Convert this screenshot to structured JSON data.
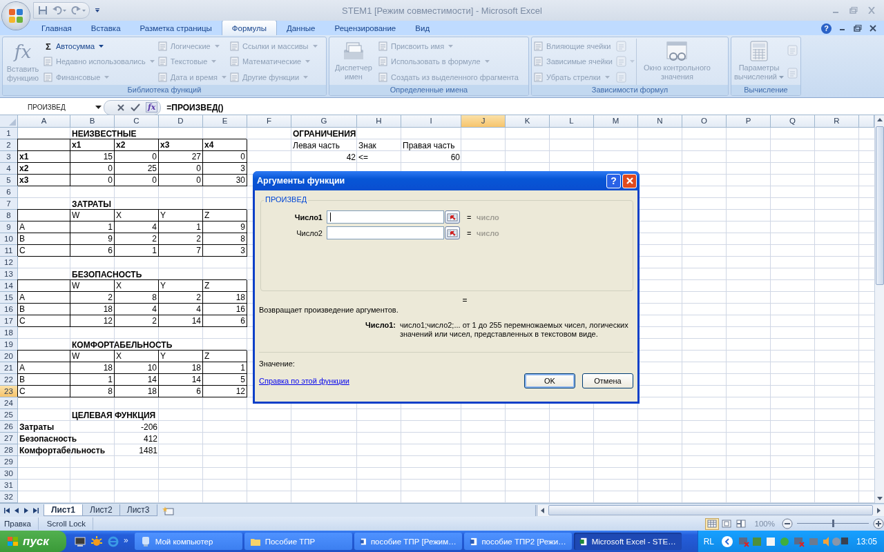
{
  "window": {
    "title": "STEM1  [Режим совместимости] - Microsoft Excel"
  },
  "ribbon": {
    "tabs": [
      {
        "label": "Главная",
        "selected": false
      },
      {
        "label": "Вставка",
        "selected": false
      },
      {
        "label": "Разметка страницы",
        "selected": false
      },
      {
        "label": "Формулы",
        "selected": true
      },
      {
        "label": "Данные",
        "selected": false
      },
      {
        "label": "Рецензирование",
        "selected": false
      },
      {
        "label": "Вид",
        "selected": false
      }
    ],
    "help": "?",
    "groups": [
      {
        "title": "Библиотека функций",
        "parts": [
          {
            "kind": "large",
            "label": "Вставить функцию",
            "glyph": "fx",
            "dropdown": false,
            "disabled": true
          },
          {
            "kind": "small",
            "items": [
              {
                "label": "Автосумма",
                "glyph": "Σ",
                "dropdown": true,
                "disabled": false
              },
              {
                "label": "Недавно использовались",
                "dropdown": true,
                "disabled": true
              },
              {
                "label": "Финансовые",
                "dropdown": true,
                "disabled": true
              }
            ]
          },
          {
            "kind": "small",
            "items": [
              {
                "label": "Логические",
                "dropdown": true,
                "disabled": true
              },
              {
                "label": "Текстовые",
                "dropdown": true,
                "disabled": true
              },
              {
                "label": "Дата и время",
                "dropdown": true,
                "disabled": true
              }
            ]
          },
          {
            "kind": "small",
            "items": [
              {
                "label": "Ссылки и массивы",
                "dropdown": true,
                "disabled": true
              },
              {
                "label": "Математические",
                "dropdown": true,
                "disabled": true
              },
              {
                "label": "Другие функции",
                "dropdown": true,
                "disabled": true
              }
            ]
          }
        ]
      },
      {
        "title": "Определенные имена",
        "parts": [
          {
            "kind": "large",
            "label": "Диспетчер имен",
            "dropdown": false,
            "disabled": true
          },
          {
            "kind": "small",
            "items": [
              {
                "label": "Присвоить имя",
                "dropdown": true,
                "disabled": true
              },
              {
                "label": "Использовать в формуле",
                "dropdown": true,
                "disabled": true
              },
              {
                "label": "Создать из выделенного фрагмента",
                "dropdown": false,
                "disabled": true
              }
            ]
          }
        ]
      },
      {
        "title": "Зависимости формул",
        "parts": [
          {
            "kind": "small",
            "items": [
              {
                "label": "Влияющие ячейки",
                "dropdown": false,
                "disabled": true
              },
              {
                "label": "Зависимые ячейки",
                "dropdown": false,
                "disabled": true
              },
              {
                "label": "Убрать стрелки",
                "dropdown": true,
                "disabled": true
              }
            ]
          },
          {
            "kind": "icons",
            "items": [
              {
                "dropdown": false,
                "disabled": true
              },
              {
                "dropdown": true,
                "disabled": true
              },
              {
                "dropdown": false,
                "disabled": true
              }
            ]
          },
          {
            "kind": "large",
            "label": "Окно контрольного значения",
            "dropdown": false,
            "disabled": true
          }
        ]
      },
      {
        "title": "Вычисление",
        "parts": [
          {
            "kind": "large",
            "label": "Параметры вычислений",
            "dropdown": true,
            "disabled": true
          },
          {
            "kind": "icons",
            "items": [
              {
                "dropdown": false,
                "disabled": true
              },
              {
                "dropdown": false,
                "disabled": true
              }
            ]
          }
        ]
      }
    ]
  },
  "formula_bar": {
    "name_box": "ПРОИЗВЕД",
    "fx": "fx",
    "formula": "=ПРОИЗВЕД()"
  },
  "sheet": {
    "columns": [
      {
        "label": "A",
        "selected": false
      },
      {
        "label": "B",
        "selected": false
      },
      {
        "label": "C",
        "selected": false
      },
      {
        "label": "D",
        "selected": false
      },
      {
        "label": "E",
        "selected": false
      },
      {
        "label": "F",
        "selected": false
      },
      {
        "label": "G",
        "selected": false
      },
      {
        "label": "H",
        "selected": false
      },
      {
        "label": "I",
        "selected": false
      },
      {
        "label": "J",
        "selected": true
      },
      {
        "label": "K",
        "selected": false
      },
      {
        "label": "L",
        "selected": false
      },
      {
        "label": "M",
        "selected": false
      },
      {
        "label": "N",
        "selected": false
      },
      {
        "label": "O",
        "selected": false
      },
      {
        "label": "P",
        "selected": false
      },
      {
        "label": "Q",
        "selected": false
      },
      {
        "label": "R",
        "selected": false
      }
    ],
    "rows": [
      {
        "n": "1",
        "selected": false,
        "boxed": false,
        "cells": [
          "",
          {
            "text": "НЕИЗВЕСТНЫЕ",
            "kind": "text",
            "bold": true
          },
          "",
          "",
          "",
          "",
          {
            "text": "ОГРАНИЧЕНИЯ",
            "kind": "text",
            "bold": true
          }
        ]
      },
      {
        "n": "2",
        "selected": false,
        "boxed": true,
        "cells": [
          "",
          {
            "text": "x1",
            "kind": "text",
            "bold": true
          },
          {
            "text": "x2",
            "kind": "text",
            "bold": true
          },
          {
            "text": "x3",
            "kind": "text",
            "bold": true
          },
          {
            "text": "x4",
            "kind": "text",
            "bold": true
          },
          "",
          {
            "text": "Левая часть",
            "kind": "text",
            "bold": false
          },
          {
            "text": "Знак",
            "kind": "text",
            "bold": false
          },
          {
            "text": "Правая часть",
            "kind": "text",
            "bold": false
          }
        ]
      },
      {
        "n": "3",
        "selected": false,
        "boxed": true,
        "cells": [
          {
            "text": "x1",
            "kind": "text",
            "bold": true
          },
          {
            "text": "15",
            "kind": "number",
            "bold": false
          },
          {
            "text": "0",
            "kind": "number",
            "bold": false
          },
          {
            "text": "27",
            "kind": "number",
            "bold": false
          },
          {
            "text": "0",
            "kind": "number",
            "bold": false
          },
          "",
          {
            "text": "42",
            "kind": "number",
            "bold": false
          },
          {
            "text": "<=",
            "kind": "text",
            "bold": false
          },
          {
            "text": "60",
            "kind": "number",
            "bold": false
          }
        ]
      },
      {
        "n": "4",
        "selected": false,
        "boxed": true,
        "cells": [
          {
            "text": "x2",
            "kind": "text",
            "bold": true
          },
          {
            "text": "0",
            "kind": "number",
            "bold": false
          },
          {
            "text": "25",
            "kind": "number",
            "bold": false
          },
          {
            "text": "0",
            "kind": "number",
            "bold": false
          },
          {
            "text": "3",
            "kind": "number",
            "bold": false
          }
        ]
      },
      {
        "n": "5",
        "selected": false,
        "boxed": true,
        "cells": [
          {
            "text": "x3",
            "kind": "text",
            "bold": true
          },
          {
            "text": "0",
            "kind": "number",
            "bold": false
          },
          {
            "text": "0",
            "kind": "number",
            "bold": false
          },
          {
            "text": "0",
            "kind": "number",
            "bold": false
          },
          {
            "text": "30",
            "kind": "number",
            "bold": false
          }
        ]
      },
      {
        "n": "6",
        "selected": false,
        "boxed": false,
        "cells": []
      },
      {
        "n": "7",
        "selected": false,
        "boxed": false,
        "cells": [
          "",
          {
            "text": "ЗАТРАТЫ",
            "kind": "text",
            "bold": true
          }
        ]
      },
      {
        "n": "8",
        "selected": false,
        "boxed": true,
        "cells": [
          "",
          {
            "text": "W",
            "kind": "text",
            "bold": false
          },
          {
            "text": "X",
            "kind": "text",
            "bold": false
          },
          {
            "text": "Y",
            "kind": "text",
            "bold": false
          },
          {
            "text": "Z",
            "kind": "text",
            "bold": false
          }
        ]
      },
      {
        "n": "9",
        "selected": false,
        "boxed": true,
        "cells": [
          {
            "text": "A",
            "kind": "text",
            "bold": false
          },
          {
            "text": "1",
            "kind": "number",
            "bold": false
          },
          {
            "text": "4",
            "kind": "number",
            "bold": false
          },
          {
            "text": "1",
            "kind": "number",
            "bold": false
          },
          {
            "text": "9",
            "kind": "number",
            "bold": false
          }
        ]
      },
      {
        "n": "10",
        "selected": false,
        "boxed": true,
        "cells": [
          {
            "text": "B",
            "kind": "text",
            "bold": false
          },
          {
            "text": "9",
            "kind": "number",
            "bold": false
          },
          {
            "text": "2",
            "kind": "number",
            "bold": false
          },
          {
            "text": "2",
            "kind": "number",
            "bold": false
          },
          {
            "text": "8",
            "kind": "number",
            "bold": false
          }
        ]
      },
      {
        "n": "11",
        "selected": false,
        "boxed": true,
        "cells": [
          {
            "text": "C",
            "kind": "text",
            "bold": false
          },
          {
            "text": "6",
            "kind": "number",
            "bold": false
          },
          {
            "text": "1",
            "kind": "number",
            "bold": false
          },
          {
            "text": "7",
            "kind": "number",
            "bold": false
          },
          {
            "text": "3",
            "kind": "number",
            "bold": false
          }
        ]
      },
      {
        "n": "12",
        "selected": false,
        "boxed": false,
        "cells": []
      },
      {
        "n": "13",
        "selected": false,
        "boxed": false,
        "cells": [
          "",
          {
            "text": "БЕЗОПАСНОСТЬ",
            "kind": "text",
            "bold": true
          }
        ]
      },
      {
        "n": "14",
        "selected": false,
        "boxed": true,
        "cells": [
          "",
          {
            "text": "W",
            "kind": "text",
            "bold": false
          },
          {
            "text": "X",
            "kind": "text",
            "bold": false
          },
          {
            "text": "Y",
            "kind": "text",
            "bold": false
          },
          {
            "text": "Z",
            "kind": "text",
            "bold": false
          }
        ]
      },
      {
        "n": "15",
        "selected": false,
        "boxed": true,
        "cells": [
          {
            "text": "A",
            "kind": "text",
            "bold": false
          },
          {
            "text": "2",
            "kind": "number",
            "bold": false
          },
          {
            "text": "8",
            "kind": "number",
            "bold": false
          },
          {
            "text": "2",
            "kind": "number",
            "bold": false
          },
          {
            "text": "18",
            "kind": "number",
            "bold": false
          }
        ]
      },
      {
        "n": "16",
        "selected": false,
        "boxed": true,
        "cells": [
          {
            "text": "B",
            "kind": "text",
            "bold": false
          },
          {
            "text": "18",
            "kind": "number",
            "bold": false
          },
          {
            "text": "4",
            "kind": "number",
            "bold": false
          },
          {
            "text": "4",
            "kind": "number",
            "bold": false
          },
          {
            "text": "16",
            "kind": "number",
            "bold": false
          }
        ]
      },
      {
        "n": "17",
        "selected": false,
        "boxed": true,
        "cells": [
          {
            "text": "C",
            "kind": "text",
            "bold": false
          },
          {
            "text": "12",
            "kind": "number",
            "bold": false
          },
          {
            "text": "2",
            "kind": "number",
            "bold": false
          },
          {
            "text": "14",
            "kind": "number",
            "bold": false
          },
          {
            "text": "6",
            "kind": "number",
            "bold": false
          }
        ]
      },
      {
        "n": "18",
        "selected": false,
        "boxed": false,
        "cells": []
      },
      {
        "n": "19",
        "selected": false,
        "boxed": false,
        "cells": [
          "",
          {
            "text": "КОМФОРТАБЕЛЬНОСТЬ",
            "kind": "text",
            "bold": true
          }
        ]
      },
      {
        "n": "20",
        "selected": false,
        "boxed": true,
        "cells": [
          "",
          {
            "text": "W",
            "kind": "text",
            "bold": false
          },
          {
            "text": "X",
            "kind": "text",
            "bold": false
          },
          {
            "text": "Y",
            "kind": "text",
            "bold": false
          },
          {
            "text": "Z",
            "kind": "text",
            "bold": false
          }
        ]
      },
      {
        "n": "21",
        "selected": false,
        "boxed": true,
        "cells": [
          {
            "text": "A",
            "kind": "text",
            "bold": false
          },
          {
            "text": "18",
            "kind": "number",
            "bold": false
          },
          {
            "text": "10",
            "kind": "number",
            "bold": false
          },
          {
            "text": "18",
            "kind": "number",
            "bold": false
          },
          {
            "text": "1",
            "kind": "number",
            "bold": false
          }
        ]
      },
      {
        "n": "22",
        "selected": false,
        "boxed": true,
        "cells": [
          {
            "text": "B",
            "kind": "text",
            "bold": false
          },
          {
            "text": "1",
            "kind": "number",
            "bold": false
          },
          {
            "text": "14",
            "kind": "number",
            "bold": false
          },
          {
            "text": "14",
            "kind": "number",
            "bold": false
          },
          {
            "text": "5",
            "kind": "number",
            "bold": false
          }
        ]
      },
      {
        "n": "23",
        "selected": true,
        "boxed": true,
        "cells": [
          {
            "text": "C",
            "kind": "text",
            "bold": false
          },
          {
            "text": "8",
            "kind": "number",
            "bold": false
          },
          {
            "text": "18",
            "kind": "number",
            "bold": false
          },
          {
            "text": "6",
            "kind": "number",
            "bold": false
          },
          {
            "text": "12",
            "kind": "number",
            "bold": false
          }
        ]
      },
      {
        "n": "24",
        "selected": false,
        "boxed": false,
        "cells": []
      },
      {
        "n": "25",
        "selected": false,
        "boxed": false,
        "cells": [
          "",
          {
            "text": "ЦЕЛЕВАЯ ФУНКЦИЯ",
            "kind": "text",
            "bold": true
          }
        ]
      },
      {
        "n": "26",
        "selected": false,
        "boxed": false,
        "cells": [
          {
            "text": "Затраты",
            "kind": "text",
            "bold": true
          },
          "",
          {
            "text": "-206",
            "kind": "number",
            "bold": false
          }
        ]
      },
      {
        "n": "27",
        "selected": false,
        "boxed": false,
        "cells": [
          {
            "text": "Безопасность",
            "kind": "text",
            "bold": true
          },
          "",
          {
            "text": "412",
            "kind": "number",
            "bold": false
          }
        ]
      },
      {
        "n": "28",
        "selected": false,
        "boxed": false,
        "cells": [
          {
            "text": "Комфортабельность",
            "kind": "text",
            "bold": true
          },
          "",
          {
            "text": "1481",
            "kind": "number",
            "bold": false
          }
        ]
      },
      {
        "n": "29",
        "selected": false,
        "boxed": false,
        "cells": []
      },
      {
        "n": "30",
        "selected": false,
        "boxed": false,
        "cells": []
      },
      {
        "n": "31",
        "selected": false,
        "boxed": false,
        "cells": []
      },
      {
        "n": "32",
        "selected": false,
        "boxed": false,
        "cells": []
      }
    ]
  },
  "sheet_tabs": [
    {
      "label": "Лист1",
      "selected": true
    },
    {
      "label": "Лист2",
      "selected": false
    },
    {
      "label": "Лист3",
      "selected": false
    }
  ],
  "status_bar": {
    "items": [
      "Правка",
      "Scroll Lock"
    ],
    "views": [
      {
        "selected": true
      },
      {
        "selected": false
      },
      {
        "selected": false
      }
    ],
    "zoom": "100%",
    "zoom_slider": {
      "level": 0.5
    }
  },
  "dialog": {
    "title": "Аргументы функции",
    "help": "?",
    "function": "ПРОИЗВЕД",
    "args": [
      {
        "label": "Число1",
        "active": true,
        "equals": "=",
        "result": "число"
      },
      {
        "label": "Число2",
        "active": false,
        "equals": "=",
        "result": "число"
      }
    ],
    "result_equals": "=",
    "description": "Возвращает произведение аргументов.",
    "arg_help_label": "Число1:",
    "arg_help": "число1;число2;... от 1 до 255 перемножаемых чисел, логических значений или чисел, представленных в текстовом виде.",
    "value_label": "Значение:",
    "help_link": "Справка по этой функции",
    "buttons": [
      {
        "label": "OK",
        "default": true
      },
      {
        "label": "Отмена",
        "default": false
      }
    ]
  },
  "taskbar": {
    "start": "пуск",
    "more": "»",
    "tasks": [
      {
        "label": "Мой компьютер",
        "selected": false
      },
      {
        "label": "Пособие ТПР",
        "selected": false
      },
      {
        "label": "пособие ТПР [Режим…",
        "selected": false
      },
      {
        "label": "пособие ТПР2 [Режи…",
        "selected": false
      },
      {
        "label": "Microsoft Excel - STE…",
        "selected": true
      }
    ],
    "language": "RL",
    "clock": "13:05"
  }
}
